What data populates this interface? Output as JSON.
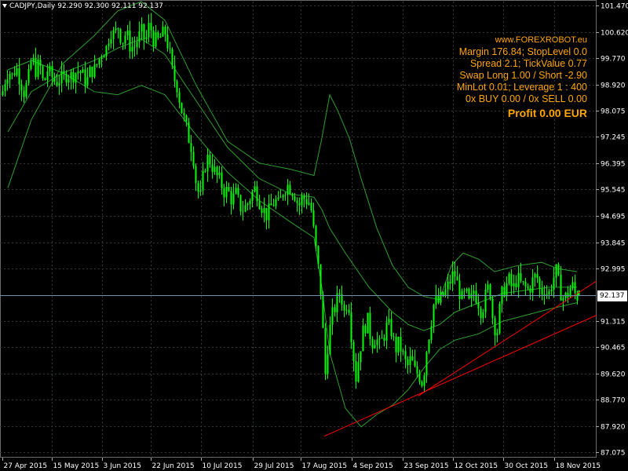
{
  "window": {
    "symbol_header": "CADJPY,Daily  92.290 92.300 92.111 92.137",
    "current_price_label": "92.137"
  },
  "info_panel": {
    "site": "www.FOREXROBOT.eu",
    "lines": [
      "Margin 176.84; StopLevel 0.0",
      "Spread 2.1; TickValue 0.77",
      "Swap Long 1.00 / Short -2.90",
      "MinLot 0.01; Leverage 1 : 400",
      "0x BUY 0.00 / 0x SELL 0.00"
    ],
    "profit": "Profit 0.00 EUR"
  },
  "colors": {
    "background": "#000000",
    "grid": "#2f3b2f",
    "candle": "#00ff00",
    "bands": "#2e9e2e",
    "trendline": "#ff0000",
    "axis_text": "#ffffff",
    "info_text": "#ffa500",
    "current_price_line": "#6e8fb0"
  },
  "chart_data": {
    "type": "candlestick",
    "symbol": "CADJPY",
    "timeframe": "Daily",
    "last_bar": {
      "open": 92.29,
      "high": 92.3,
      "low": 92.111,
      "close": 92.137
    },
    "current_price": 92.137,
    "ylim": [
      86.91,
      101.6
    ],
    "y_ticks": [
      "101.470",
      "100.620",
      "99.770",
      "98.920",
      "98.075",
      "97.245",
      "96.395",
      "95.545",
      "94.695",
      "93.845",
      "92.995",
      "92.137",
      "91.315",
      "90.465",
      "89.620",
      "88.770",
      "87.920",
      "87.075"
    ],
    "x_ticks": [
      "27 Apr 2015",
      "15 May 2015",
      "3 Jun 2015",
      "22 Jun 2015",
      "10 Jul 2015",
      "29 Jul 2015",
      "17 Aug 2015",
      "4 Sep 2015",
      "23 Sep 2015",
      "12 Oct 2015",
      "30 Oct 2015",
      "18 Nov 2015"
    ],
    "close_path": [
      [
        0,
        98.3
      ],
      [
        5,
        99.0
      ],
      [
        10,
        99.4
      ],
      [
        15,
        99.2
      ],
      [
        20,
        99.5
      ],
      [
        25,
        99.1
      ],
      [
        30,
        98.7
      ],
      [
        35,
        99.0
      ],
      [
        40,
        99.8
      ],
      [
        45,
        99.4
      ],
      [
        50,
        99.6
      ],
      [
        55,
        98.9
      ],
      [
        60,
        99.4
      ],
      [
        65,
        99.2
      ],
      [
        70,
        99.0
      ],
      [
        75,
        99.1
      ],
      [
        80,
        99.1
      ],
      [
        85,
        99.3
      ],
      [
        90,
        99.2
      ],
      [
        95,
        99.3
      ],
      [
        100,
        99.4
      ],
      [
        105,
        99.2
      ],
      [
        110,
        99.0
      ],
      [
        115,
        99.4
      ],
      [
        120,
        99.4
      ],
      [
        125,
        99.7
      ],
      [
        130,
        100.0
      ],
      [
        135,
        100.1
      ],
      [
        140,
        100.7
      ],
      [
        145,
        100.5
      ],
      [
        150,
        100.8
      ],
      [
        155,
        100.3
      ],
      [
        160,
        100.6
      ],
      [
        165,
        100.2
      ],
      [
        170,
        100.1
      ],
      [
        175,
        100.4
      ],
      [
        180,
        100.6
      ],
      [
        185,
        100.3
      ],
      [
        190,
        100.9
      ],
      [
        195,
        100.4
      ],
      [
        200,
        100.3
      ],
      [
        205,
        100.5
      ],
      [
        210,
        100.6
      ],
      [
        215,
        100.0
      ],
      [
        220,
        99.2
      ],
      [
        225,
        98.9
      ],
      [
        230,
        98.2
      ],
      [
        235,
        97.7
      ],
      [
        240,
        97.2
      ],
      [
        245,
        96.8
      ],
      [
        250,
        95.6
      ],
      [
        255,
        95.3
      ],
      [
        260,
        96.3
      ],
      [
        265,
        96.6
      ],
      [
        270,
        96.3
      ],
      [
        275,
        96.0
      ],
      [
        280,
        95.8
      ],
      [
        285,
        95.5
      ],
      [
        290,
        95.5
      ],
      [
        295,
        95.2
      ],
      [
        300,
        95.4
      ],
      [
        305,
        95.0
      ],
      [
        310,
        94.9
      ],
      [
        315,
        95.1
      ],
      [
        320,
        95.4
      ],
      [
        325,
        95.6
      ],
      [
        330,
        95.2
      ],
      [
        335,
        94.9
      ],
      [
        340,
        94.7
      ],
      [
        345,
        95.0
      ],
      [
        350,
        95.2
      ],
      [
        355,
        95.0
      ],
      [
        360,
        95.5
      ],
      [
        365,
        95.7
      ],
      [
        370,
        95.6
      ],
      [
        375,
        95.4
      ],
      [
        380,
        95.0
      ],
      [
        385,
        95.3
      ],
      [
        390,
        95.2
      ],
      [
        395,
        95.1
      ],
      [
        400,
        94.0
      ],
      [
        405,
        93.0
      ],
      [
        410,
        91.8
      ],
      [
        413,
        89.3
      ],
      [
        418,
        90.8
      ],
      [
        423,
        91.5
      ],
      [
        428,
        91.9
      ],
      [
        433,
        92.3
      ],
      [
        438,
        91.6
      ],
      [
        443,
        92.1
      ],
      [
        448,
        90.6
      ],
      [
        453,
        89.5
      ],
      [
        458,
        90.4
      ],
      [
        463,
        91.1
      ],
      [
        468,
        91.3
      ],
      [
        473,
        90.6
      ],
      [
        478,
        90.8
      ],
      [
        483,
        90.5
      ],
      [
        488,
        90.8
      ],
      [
        493,
        91.2
      ],
      [
        498,
        91.0
      ],
      [
        503,
        90.4
      ],
      [
        508,
        90.6
      ],
      [
        513,
        90.2
      ],
      [
        518,
        89.8
      ],
      [
        523,
        90.1
      ],
      [
        528,
        89.7
      ],
      [
        533,
        89.6
      ],
      [
        538,
        89.3
      ],
      [
        543,
        90.4
      ],
      [
        548,
        91.2
      ],
      [
        553,
        92.0
      ],
      [
        558,
        91.9
      ],
      [
        563,
        92.1
      ],
      [
        568,
        92.3
      ],
      [
        573,
        92.6
      ],
      [
        578,
        92.9
      ],
      [
        583,
        92.4
      ],
      [
        588,
        92.0
      ],
      [
        593,
        92.2
      ],
      [
        598,
        91.8
      ],
      [
        603,
        92.3
      ],
      [
        608,
        92.0
      ],
      [
        613,
        91.6
      ],
      [
        618,
        92.1
      ],
      [
        623,
        92.5
      ],
      [
        628,
        91.2
      ],
      [
        633,
        91.0
      ],
      [
        638,
        92.1
      ],
      [
        643,
        92.4
      ],
      [
        648,
        92.6
      ],
      [
        653,
        92.3
      ],
      [
        658,
        92.7
      ],
      [
        663,
        92.5
      ],
      [
        668,
        92.4
      ],
      [
        673,
        92.3
      ],
      [
        678,
        92.6
      ],
      [
        683,
        92.8
      ],
      [
        688,
        92.2
      ],
      [
        693,
        92.4
      ],
      [
        698,
        92.1
      ],
      [
        703,
        92.6
      ],
      [
        708,
        92.9
      ],
      [
        713,
        92.3
      ],
      [
        718,
        92.0
      ],
      [
        723,
        92.2
      ],
      [
        728,
        92.5
      ],
      [
        733,
        92.1
      ],
      [
        738,
        92.14
      ]
    ],
    "upper_band": [
      [
        10,
        95.6
      ],
      [
        40,
        97.8
      ],
      [
        80,
        99.6
      ],
      [
        120,
        100.5
      ],
      [
        150,
        101.3
      ],
      [
        180,
        101.6
      ],
      [
        210,
        101.0
      ],
      [
        250,
        98.9
      ],
      [
        290,
        97.1
      ],
      [
        330,
        96.4
      ],
      [
        370,
        96.2
      ],
      [
        400,
        96.0
      ],
      [
        410,
        97.2
      ],
      [
        420,
        98.6
      ],
      [
        430,
        98.1
      ],
      [
        445,
        97.2
      ],
      [
        460,
        95.9
      ],
      [
        480,
        94.3
      ],
      [
        500,
        93.1
      ],
      [
        520,
        92.4
      ],
      [
        540,
        92.1
      ],
      [
        560,
        92.0
      ],
      [
        575,
        93.1
      ],
      [
        590,
        93.5
      ],
      [
        610,
        93.3
      ],
      [
        630,
        92.9
      ],
      [
        660,
        93.1
      ],
      [
        690,
        93.2
      ],
      [
        710,
        93.0
      ],
      [
        735,
        92.9
      ]
    ],
    "middle_band": [
      [
        10,
        97.4
      ],
      [
        40,
        98.7
      ],
      [
        80,
        99.3
      ],
      [
        120,
        99.7
      ],
      [
        150,
        100.1
      ],
      [
        180,
        100.4
      ],
      [
        210,
        99.9
      ],
      [
        250,
        98.4
      ],
      [
        290,
        96.9
      ],
      [
        330,
        95.9
      ],
      [
        370,
        95.4
      ],
      [
        400,
        95.3
      ],
      [
        410,
        94.9
      ],
      [
        420,
        94.3
      ],
      [
        440,
        93.5
      ],
      [
        470,
        92.4
      ],
      [
        500,
        91.6
      ],
      [
        520,
        91.2
      ],
      [
        540,
        91.0
      ],
      [
        560,
        91.2
      ],
      [
        580,
        91.6
      ],
      [
        610,
        91.9
      ],
      [
        640,
        92.2
      ],
      [
        670,
        92.3
      ],
      [
        700,
        92.4
      ],
      [
        735,
        92.4
      ]
    ],
    "lower_band": [
      [
        10,
        99.4
      ],
      [
        40,
        99.7
      ],
      [
        80,
        99.3
      ],
      [
        120,
        98.7
      ],
      [
        150,
        98.6
      ],
      [
        180,
        98.9
      ],
      [
        210,
        98.6
      ],
      [
        250,
        97.3
      ],
      [
        290,
        96.1
      ],
      [
        330,
        95.2
      ],
      [
        370,
        94.5
      ],
      [
        400,
        94.0
      ],
      [
        410,
        92.4
      ],
      [
        420,
        90.3
      ],
      [
        440,
        88.5
      ],
      [
        460,
        87.9
      ],
      [
        480,
        88.3
      ],
      [
        500,
        88.6
      ],
      [
        520,
        89.1
      ],
      [
        540,
        89.8
      ],
      [
        560,
        90.4
      ],
      [
        580,
        90.7
      ],
      [
        610,
        90.9
      ],
      [
        640,
        91.3
      ],
      [
        670,
        91.5
      ],
      [
        700,
        91.7
      ],
      [
        735,
        91.9
      ]
    ],
    "trendlines": [
      {
        "from": [
          413,
          87.6
        ],
        "to": [
          760,
          91.5
        ]
      },
      {
        "from": [
          533,
          88.9
        ],
        "to": [
          760,
          92.6
        ]
      }
    ]
  }
}
